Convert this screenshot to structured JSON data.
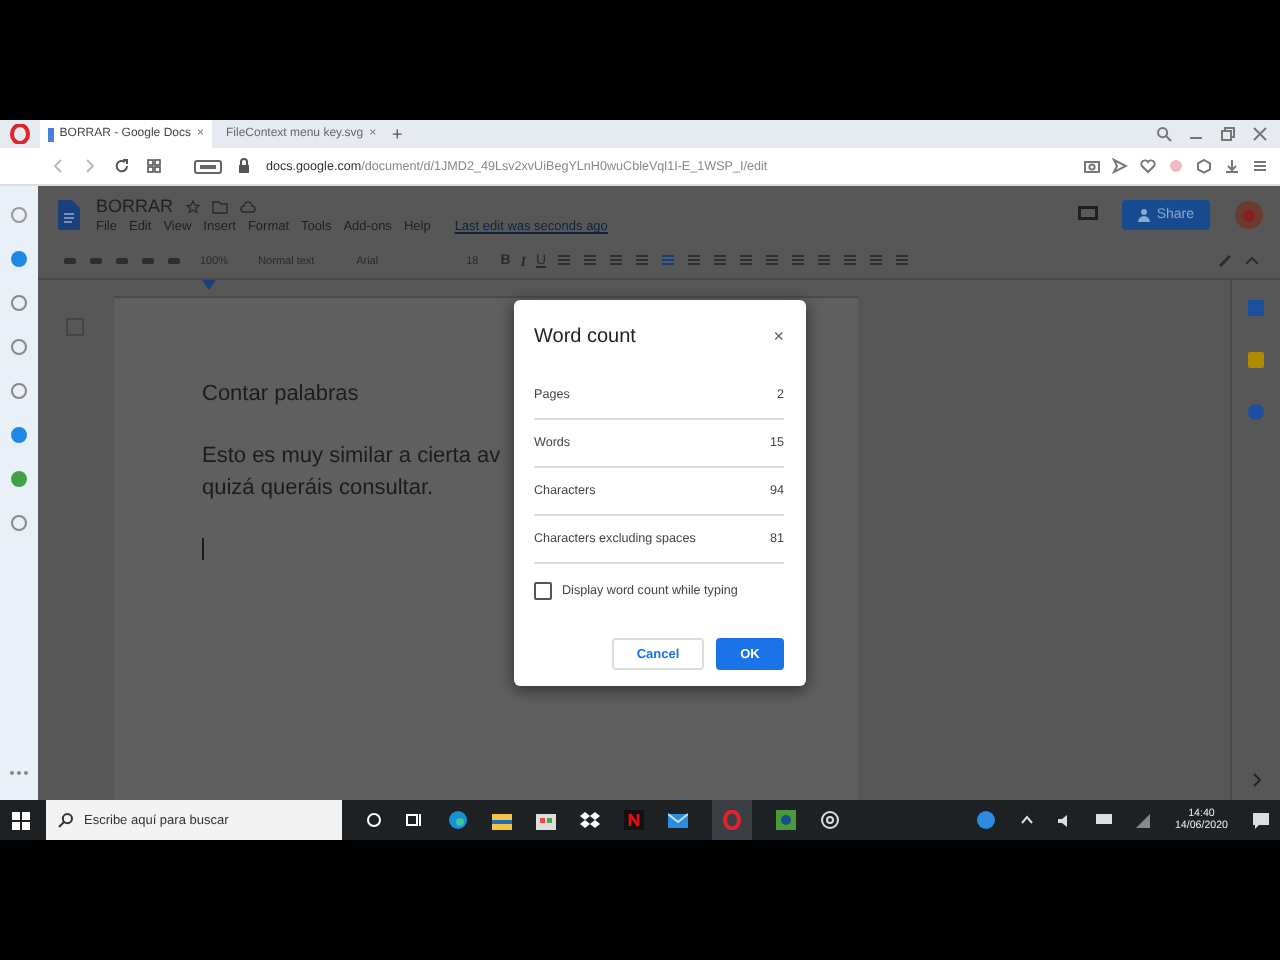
{
  "browser": {
    "tabs": [
      {
        "title": "BORRAR - Google Docs",
        "close": "×",
        "selected": true
      },
      {
        "title": "FileContext menu key.svg",
        "close": "×",
        "selected": false
      }
    ],
    "new_tab": "+",
    "url_host": "docs.google.com",
    "url_path": "/document/d/1JMD2_49Lsv2xvUiBegYLnH0wuCbleVql1I-E_1WSP_I/edit"
  },
  "docs": {
    "title": "BORRAR",
    "menu": [
      "File",
      "Edit",
      "View",
      "Insert",
      "Format",
      "Tools",
      "Add-ons",
      "Help"
    ],
    "last_edit": "Last edit was seconds ago",
    "share": "Share",
    "toolbar": {
      "zoom": "100%",
      "style": "Normal text",
      "font": "Arial",
      "size": "18",
      "format": [
        "B",
        "I",
        "U"
      ]
    },
    "paragraphs": [
      [
        "Contar palabras"
      ],
      [
        "Esto es muy similar a cierta av",
        "quizá queráis consultar."
      ]
    ]
  },
  "dialog": {
    "title": "Word count",
    "close": "×",
    "rows": [
      {
        "label": "Pages",
        "value": "2"
      },
      {
        "label": "Words",
        "value": "15"
      },
      {
        "label": "Characters",
        "value": "94"
      },
      {
        "label": "Characters excluding spaces",
        "value": "81"
      }
    ],
    "checkbox": {
      "label": "Display word count while typing",
      "checked": false
    },
    "cancel": "Cancel",
    "ok": "OK"
  },
  "taskbar": {
    "search_placeholder": "Escribe aquí para buscar",
    "time": "14:40",
    "date": "14/06/2020"
  }
}
